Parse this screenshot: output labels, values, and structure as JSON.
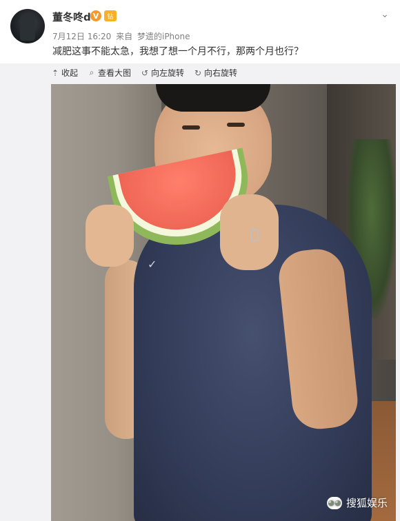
{
  "post": {
    "username": "董冬咚d",
    "badges": {
      "verified_label": "V",
      "member_label": "钻"
    },
    "date": "7月12日 16:20",
    "source_prefix": "来自",
    "source_name": "梦遗的iPhone",
    "text": "减肥这事不能太急，我想了想一个月不行，那两个月也行？",
    "menu_icon": "chevron-down-icon"
  },
  "toolbar": {
    "items": [
      {
        "icon": "arrow-up-icon",
        "label": "收起"
      },
      {
        "icon": "search-icon",
        "label": "查看大图"
      },
      {
        "icon": "rotate-left-icon",
        "label": "向左旋转"
      },
      {
        "icon": "rotate-right-icon",
        "label": "向右旋转"
      }
    ]
  },
  "watermark": {
    "icon": "wechat-icon",
    "label": "搜狐娱乐"
  },
  "colors": {
    "username": "#333333",
    "meta": "#808080",
    "toolbar_bg": "#f2f2f5",
    "verified_badge": "#f29a2b"
  }
}
